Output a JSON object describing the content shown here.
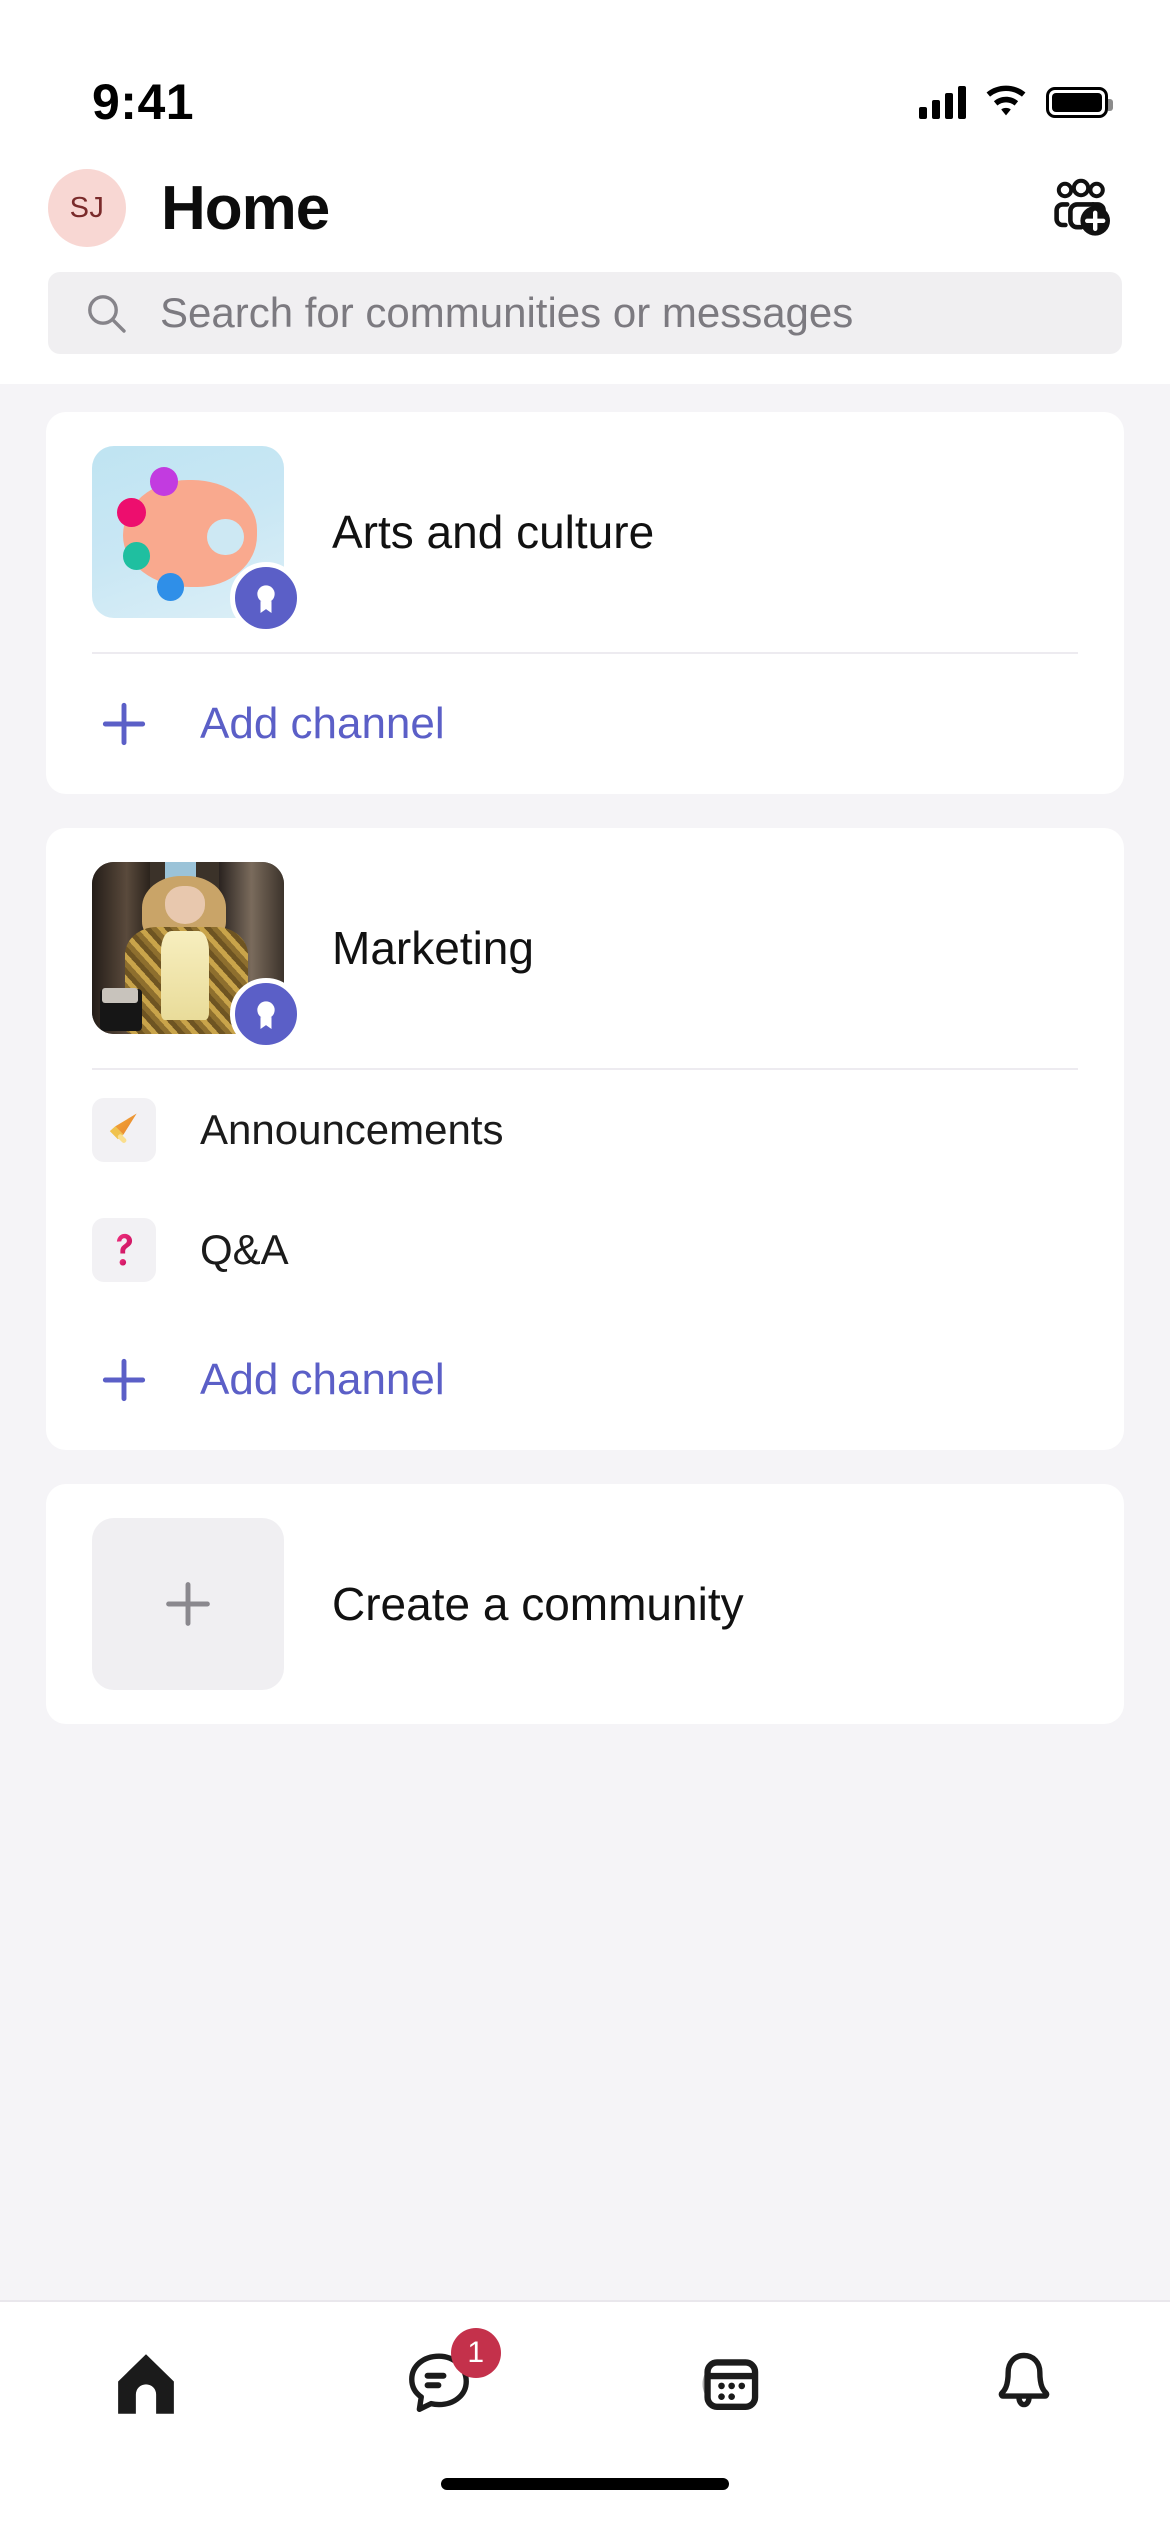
{
  "status_bar": {
    "time": "9:41",
    "cellular_icon": "cellular-signal-icon",
    "wifi_icon": "wifi-icon",
    "battery_icon": "battery-full-icon"
  },
  "header": {
    "avatar_initials": "SJ",
    "title": "Home",
    "action_icon": "add-people-icon"
  },
  "search": {
    "placeholder": "Search for communities or messages",
    "icon": "search-icon",
    "value": ""
  },
  "communities": [
    {
      "name": "Arts and culture",
      "avatar_icon": "art-palette-icon",
      "badge_icon": "award-medal-icon",
      "channels": [],
      "add_channel_label": "Add channel",
      "add_channel_icon": "plus-icon"
    },
    {
      "name": "Marketing",
      "avatar_icon": "photo-avatar",
      "badge_icon": "award-medal-icon",
      "channels": [
        {
          "name": "Announcements",
          "icon": "megaphone-icon"
        },
        {
          "name": "Q&A",
          "icon": "question-mark-icon"
        }
      ],
      "add_channel_label": "Add channel",
      "add_channel_icon": "plus-icon"
    }
  ],
  "create_community": {
    "label": "Create a community",
    "icon": "plus-icon"
  },
  "tab_bar": {
    "tabs": [
      {
        "name": "home",
        "icon": "home-icon",
        "active": true,
        "badge": ""
      },
      {
        "name": "chat",
        "icon": "chat-bubble-icon",
        "active": false,
        "badge": "1"
      },
      {
        "name": "calendar",
        "icon": "calendar-icon",
        "active": false,
        "badge": ""
      },
      {
        "name": "activity",
        "icon": "bell-icon",
        "active": false,
        "badge": ""
      }
    ]
  },
  "colors": {
    "accent_purple": "#5B5FC7",
    "badge_red": "#C4314B",
    "page_background": "#F5F4F7",
    "card_background": "#FFFFFF",
    "avatar_background": "#F8D7D3",
    "avatar_text": "#7A2A2A",
    "search_background": "#F0EFF1",
    "placeholder_text": "#7C7A80"
  }
}
